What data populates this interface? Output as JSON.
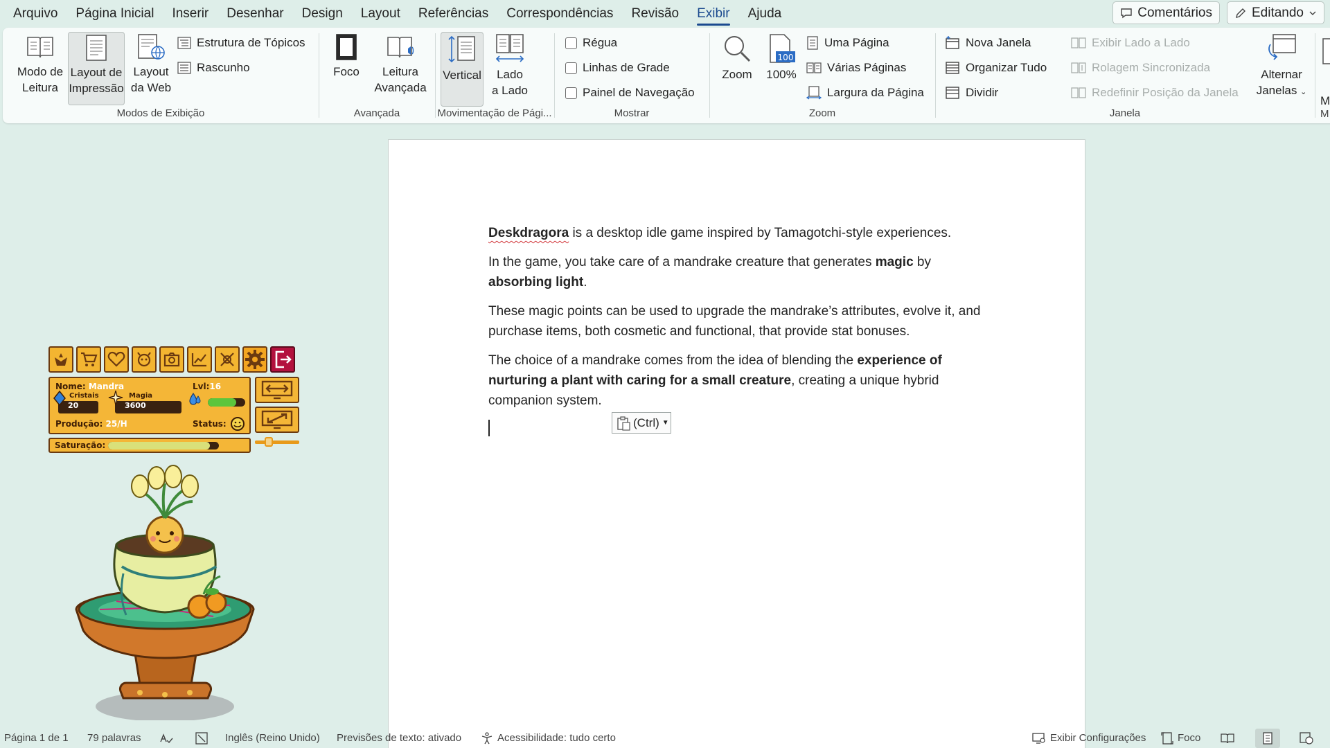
{
  "menu": {
    "tabs": [
      "Arquivo",
      "Página Inicial",
      "Inserir",
      "Desenhar",
      "Design",
      "Layout",
      "Referências",
      "Correspondências",
      "Revisão",
      "Exibir",
      "Ajuda"
    ],
    "active_tab": "Exibir",
    "comments_label": "Comentários",
    "editing_label": "Editando"
  },
  "ribbon": {
    "modos": {
      "label": "Modos de Exibição",
      "reading_l1": "Modo de",
      "reading_l2": "Leitura",
      "print_l1": "Layout de",
      "print_l2": "Impressão",
      "web_l1": "Layout",
      "web_l2": "da Web",
      "outline": "Estrutura de Tópicos",
      "draft": "Rascunho"
    },
    "avancada": {
      "label": "Avançada",
      "focus": "Foco",
      "immersive_l1": "Leitura",
      "immersive_l2": "Avançada"
    },
    "movimentacao": {
      "label": "Movimentação de Pági...",
      "vertical": "Vertical",
      "side_l1": "Lado",
      "side_l2": "a Lado"
    },
    "mostrar": {
      "label": "Mostrar",
      "ruler": "Régua",
      "gridlines": "Linhas de Grade",
      "navpane": "Painel de Navegação"
    },
    "zoom": {
      "label": "Zoom",
      "zoom": "Zoom",
      "hundred": "100%",
      "hundred_badge": "100",
      "one_page": "Uma Página",
      "multi_page": "Várias Páginas",
      "page_width": "Largura da Página"
    },
    "janela": {
      "label": "Janela",
      "new_window": "Nova Janela",
      "arrange_all": "Organizar Tudo",
      "split": "Dividir",
      "side_by_side": "Exibir Lado a Lado",
      "sync_scroll": "Rolagem Sincronizada",
      "reset_pos": "Redefinir Posição da Janela",
      "switch_l1": "Alternar",
      "switch_l2": "Janelas"
    },
    "macros": {
      "label_initial": "M"
    }
  },
  "document": {
    "p1_brand": "Deskdragora",
    "p1_rest": " is a desktop idle game inspired by Tamagotchi-style experiences.",
    "p2_a": "In the game, you take care of a mandrake creature that generates ",
    "p2_b": "magic",
    "p2_c": " by ",
    "p2_d": "absorbing light",
    "p2_e": ".",
    "p3": "These magic points can be used to upgrade the mandrake’s attributes, evolve it, and purchase items, both cosmetic and functional, that provide stat bonuses.",
    "p4_a": "The choice of a mandrake comes from the idea of blending the ",
    "p4_b": "experience of nurturing a plant with caring for a small creature",
    "p4_c": ", creating a unique hybrid companion system.",
    "paste_label": "(Ctrl)"
  },
  "game": {
    "name_label": "Nome:",
    "name_value": "Mandra",
    "level_label": "Lvl:",
    "level_value": "16",
    "crystals_label": "Cristais",
    "crystals_value": "20",
    "magic_label": "Magia",
    "magic_value": "3600",
    "production_label": "Produção:",
    "production_value": "25/H",
    "status_label": "Status:",
    "saturation_label": "Saturação:",
    "water_level": 0.75,
    "saturation_level": 0.92
  },
  "statusbar": {
    "page": "Página 1 de 1",
    "words": "79 palavras",
    "language": "Inglês (Reino Unido)",
    "predictions": "Previsões de texto: ativado",
    "accessibility": "Acessibilidade: tudo certo",
    "display_settings": "Exibir Configurações",
    "focus": "Foco"
  },
  "colors": {
    "accent": "#1b4a8f",
    "app_bg": "#deeee9",
    "game_panel": "#f4b637",
    "game_border": "#6b3a10",
    "exit_red": "#b3123e"
  }
}
